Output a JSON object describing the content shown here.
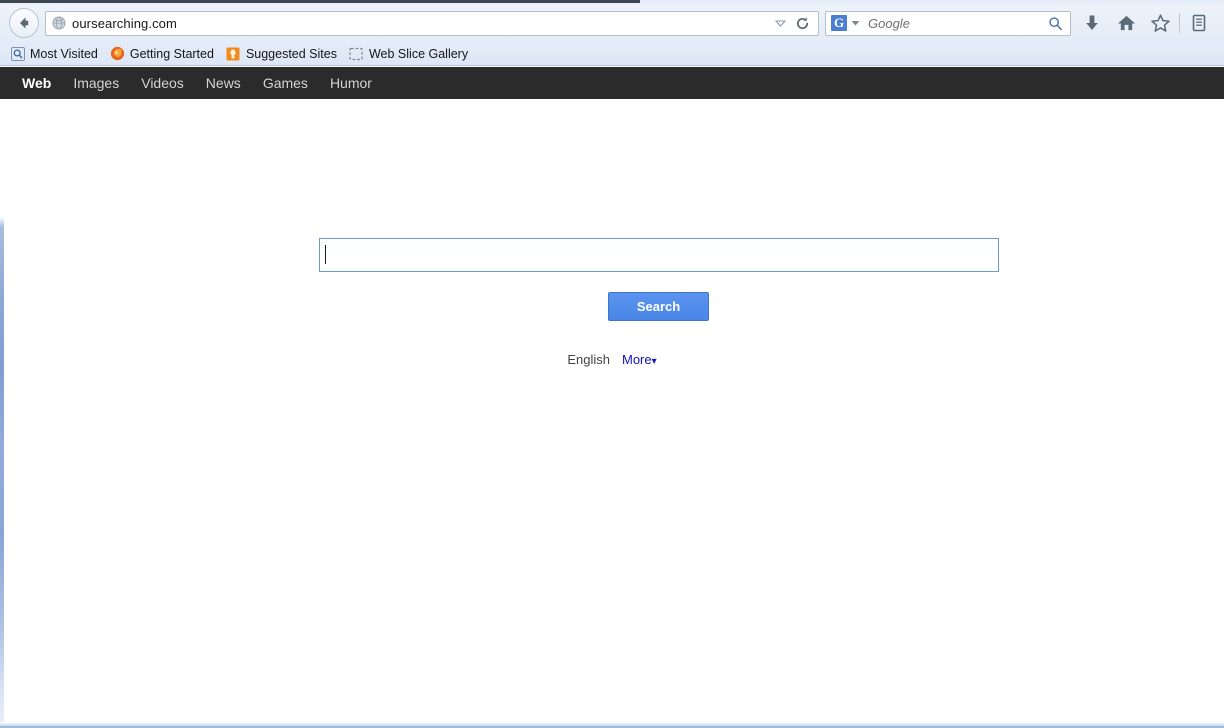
{
  "browser": {
    "back_button": "back-arrow",
    "url": "oursearching.com",
    "url_favicon": "globe-icon",
    "url_dropdown": "chevron-down-icon",
    "url_reload": "reload-icon",
    "search": {
      "engine_logo": "G",
      "engine_name": "Google",
      "placeholder": "Google",
      "value": "",
      "magnifier": "search-icon",
      "caret": "chevron-down-icon"
    },
    "toolbar_icons": [
      {
        "name": "downloads-icon",
        "glyph": "download"
      },
      {
        "name": "home-icon",
        "glyph": "home"
      },
      {
        "name": "bookmark-star-icon",
        "glyph": "star"
      },
      {
        "name": "library-icon",
        "glyph": "library"
      }
    ],
    "bookmarks": [
      {
        "label": "Most Visited",
        "icon": "most-visited-icon"
      },
      {
        "label": "Getting Started",
        "icon": "firefox-icon"
      },
      {
        "label": "Suggested Sites",
        "icon": "suggested-sites-icon"
      },
      {
        "label": "Web Slice Gallery",
        "icon": "web-slice-icon"
      }
    ]
  },
  "page": {
    "nav": [
      {
        "label": "Web",
        "active": true
      },
      {
        "label": "Images",
        "active": false
      },
      {
        "label": "Videos",
        "active": false
      },
      {
        "label": "News",
        "active": false
      },
      {
        "label": "Games",
        "active": false
      },
      {
        "label": "Humor",
        "active": false
      }
    ],
    "search": {
      "input_value": "",
      "input_placeholder": "",
      "button_label": "Search"
    },
    "language": {
      "current": "English",
      "more_label": "More",
      "more_caret": "▾"
    }
  },
  "colors": {
    "nav_bar_bg": "#2b2b2b",
    "nav_active_text": "#ffffff",
    "nav_text": "#d4d4d4",
    "search_button_bg": "#4a86e8",
    "input_border": "#6f96cd",
    "link_blue": "#1212b8",
    "chrome_bg": "#e3ecf7"
  }
}
